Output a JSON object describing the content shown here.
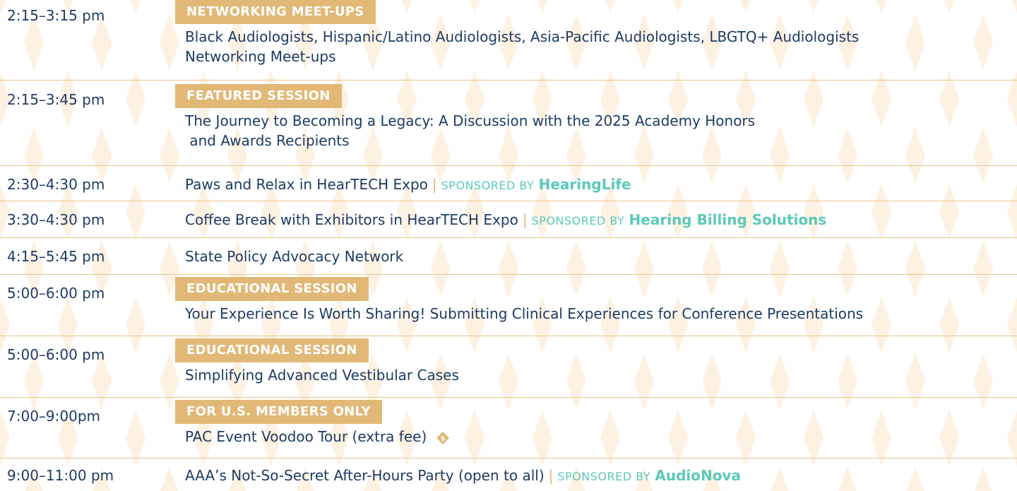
{
  "colors": {
    "badge": "#e2b877",
    "text": "#1d3b63",
    "sponsor": "#5cc9b9",
    "divider": "#e8c48e",
    "pattern": "#fdf3e6"
  },
  "schedule": [
    {
      "time": "2:15–3:15 pm",
      "badge": "NETWORKING MEET-UPS",
      "lines": [
        "Black Audiologists, Hispanic/Latino Audiologists, Asia-Pacific Audiologists, LBGTQ+ Audiologists",
        "Networking Meet-ups"
      ]
    },
    {
      "time": "2:15–3:45 pm",
      "badge": "FEATURED SESSION",
      "lines": [
        "The Journey to Becoming a Legacy: A Discussion with the 2025 Academy Honors",
        " and Awards Recipients"
      ]
    },
    {
      "time": "2:30–4:30 pm",
      "title": "Paws and Relax in HearTECH Expo",
      "separator": "|",
      "sponsored_label": "SPONSORED BY",
      "sponsor": "HearingLife"
    },
    {
      "time": "3:30–4:30 pm",
      "title": "Coffee Break with Exhibitors in HearTECH Expo",
      "separator": "|",
      "sponsored_label": "SPONSORED BY",
      "sponsor": "Hearing Billing Solutions"
    },
    {
      "time": "4:15–5:45 pm",
      "title": "State Policy Advocacy Network"
    },
    {
      "time": "5:00–6:00 pm",
      "badge": "EDUCATIONAL SESSION",
      "lines": [
        "Your Experience Is Worth Sharing! Submitting Clinical Experiences for Conference Presentations"
      ]
    },
    {
      "time": "5:00–6:00 pm",
      "badge": "EDUCATIONAL SESSION",
      "lines": [
        "Simplifying Advanced Vestibular Cases"
      ]
    },
    {
      "time": "7:00–9:00pm",
      "badge": "FOR U.S. MEMBERS ONLY",
      "lines": [
        "PAC Event Voodoo Tour (extra fee)"
      ],
      "icon": "dollar-diamond-icon",
      "icon_symbol": "$"
    },
    {
      "time": "9:00–11:00 pm",
      "title": "AAA’s Not-So-Secret After-Hours Party (open to all)",
      "separator": "|",
      "sponsored_label": "SPONSORED BY",
      "sponsor": "AudioNova"
    }
  ]
}
